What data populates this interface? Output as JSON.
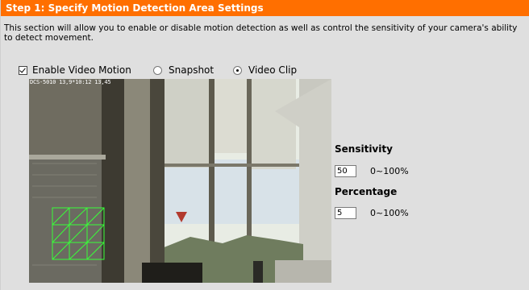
{
  "header": {
    "title": "Step 1: Specify Motion Detection Area Settings"
  },
  "description": "This section will allow you to enable or disable motion detection as well as control the sensitivity of your camera's ability to detect movement.",
  "options": {
    "enable_label": "Enable Video Motion",
    "enable_checked": true,
    "snapshot_label": "Snapshot",
    "videoclip_label": "Video Clip",
    "selected": "Video Clip"
  },
  "video": {
    "overlay_text": "DCS-5010 13,9*10:12 13,45"
  },
  "sensitivity": {
    "label": "Sensitivity",
    "value": "50",
    "range": "0~100%"
  },
  "percentage": {
    "label": "Percentage",
    "value": "5",
    "range": "0~100%"
  },
  "colors": {
    "header": "#ff6f00",
    "panel": "#dfdfdf",
    "grid": "#39ff39"
  }
}
